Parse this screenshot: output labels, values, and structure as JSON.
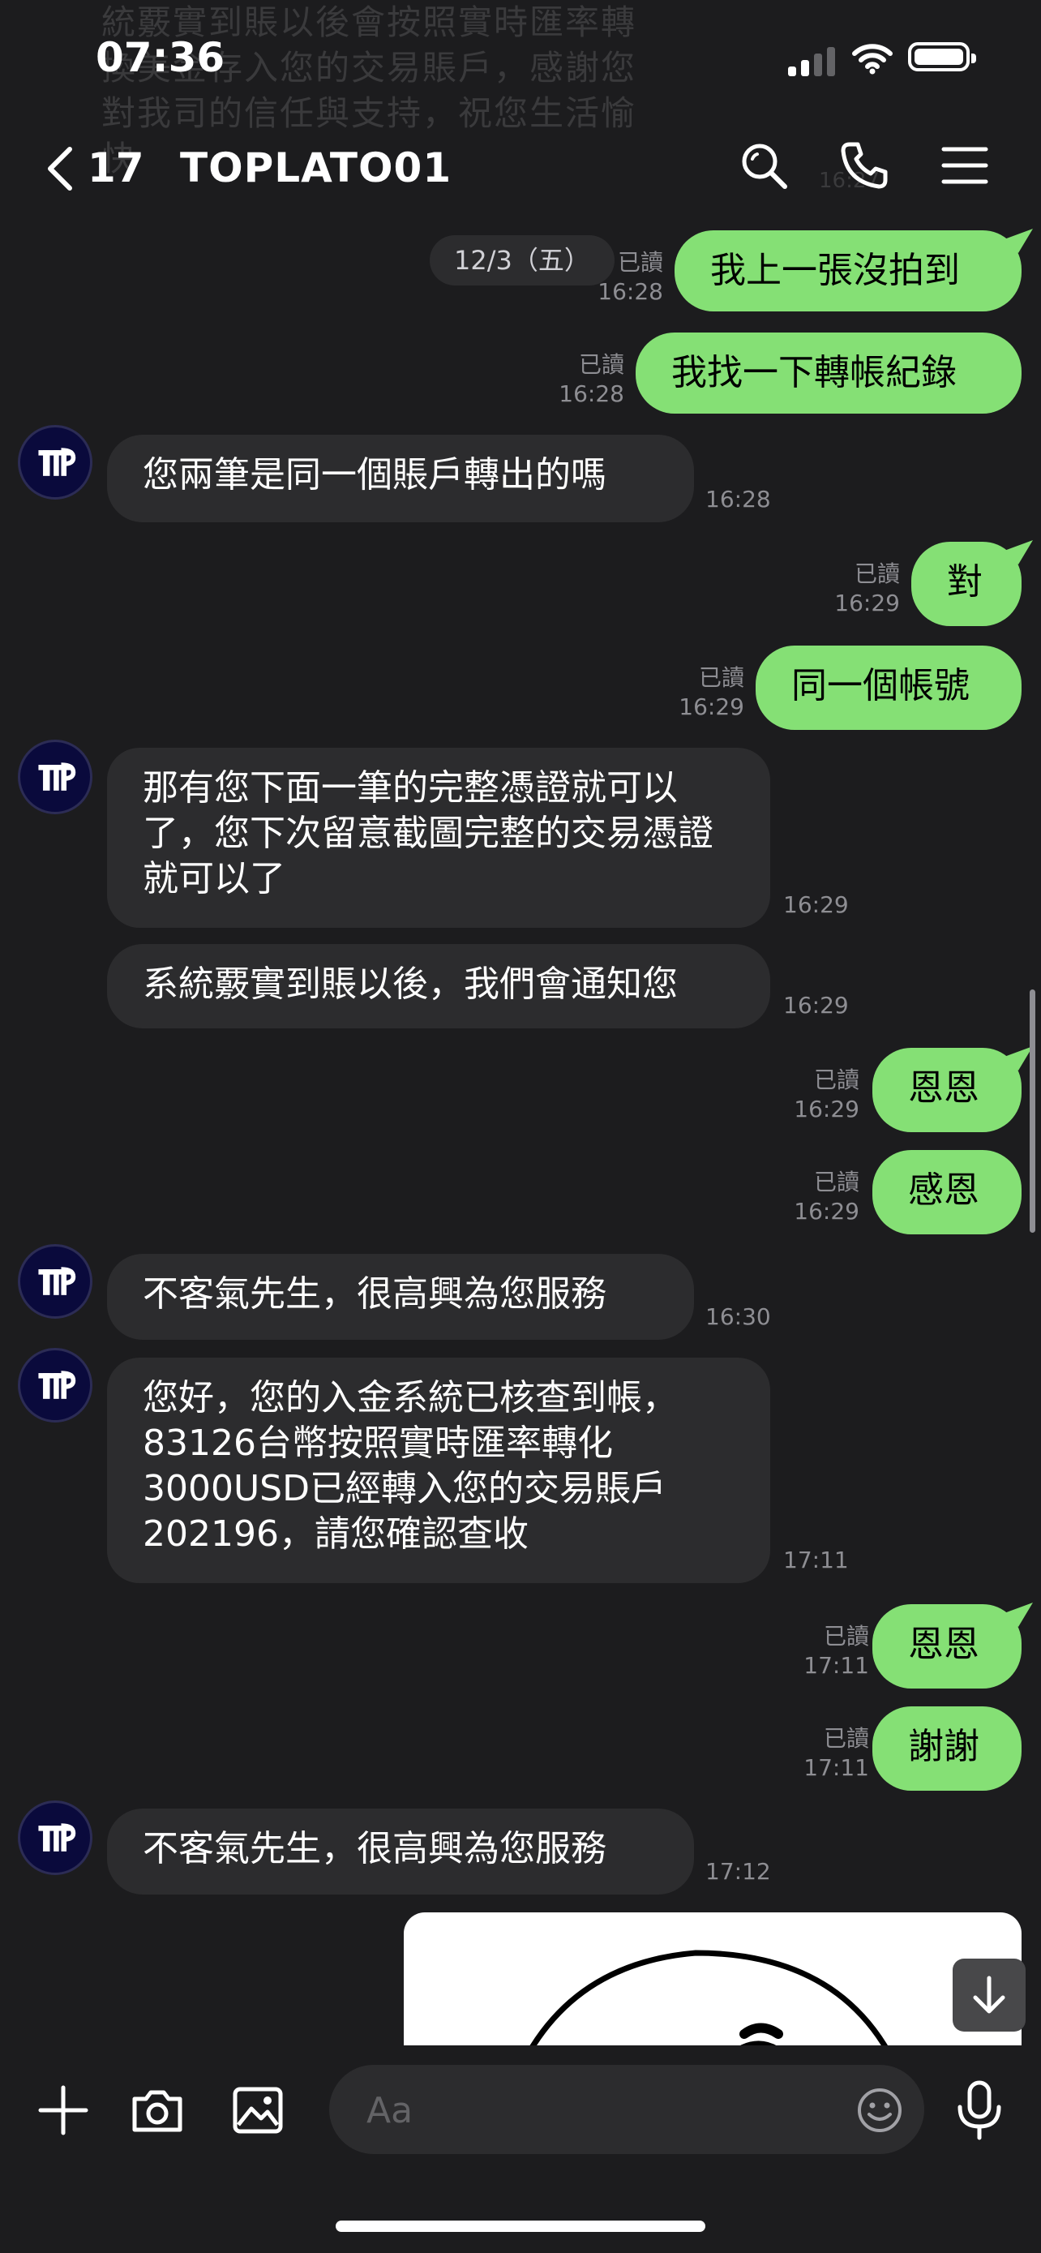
{
  "status_bar": {
    "time": "07:36"
  },
  "ghost_text": {
    "lines": "統覈實到賬以後會按照實時匯率轉\n換美金存入您的交易賬戶，感謝您\n對我司的信任與支持，祝您生活愉\n快",
    "time": "16:27"
  },
  "header": {
    "unread_count": "17",
    "chat_name": "TOPLATO01"
  },
  "date_chip": "12/3（五）",
  "read_label": "已讀",
  "messages": [
    {
      "side": "out",
      "text": "我上一張沒拍到",
      "time": "16:28"
    },
    {
      "side": "out",
      "text": "我找一下轉帳紀錄",
      "time": "16:28"
    },
    {
      "side": "in",
      "text": "您兩筆是同一個賬戶轉出的嗎",
      "time": "16:28"
    },
    {
      "side": "out",
      "text": "對",
      "time": "16:29"
    },
    {
      "side": "out",
      "text": "同一個帳號",
      "time": "16:29"
    },
    {
      "side": "in",
      "text": "那有您下面一筆的完整憑證就可以了，您下次留意截圖完整的交易憑證就可以了",
      "time": "16:29"
    },
    {
      "side": "in",
      "text": "系統覈實到賬以後，我們會通知您",
      "time": "16:29"
    },
    {
      "side": "out",
      "text": "恩恩",
      "time": "16:29"
    },
    {
      "side": "out",
      "text": "感恩",
      "time": "16:29"
    },
    {
      "side": "in",
      "text": "不客氣先生，很高興為您服務",
      "time": "16:30"
    },
    {
      "side": "in",
      "text": "您好，您的入金系統已核查到帳，83126台幣按照實時匯率轉化3000USD已經轉入您的交易賬戶202196，請您確認查收",
      "time": "17:11"
    },
    {
      "side": "out",
      "text": "恩恩",
      "time": "17:11"
    },
    {
      "side": "out",
      "text": "謝謝",
      "time": "17:11"
    },
    {
      "side": "in",
      "text": "不客氣先生，很高興為您服務",
      "time": "17:12"
    }
  ],
  "input": {
    "placeholder": "Aa"
  },
  "colors": {
    "outgoing_bubble": "#85e075",
    "incoming_bubble": "#2c2c2e",
    "background": "#1c1c1e"
  }
}
